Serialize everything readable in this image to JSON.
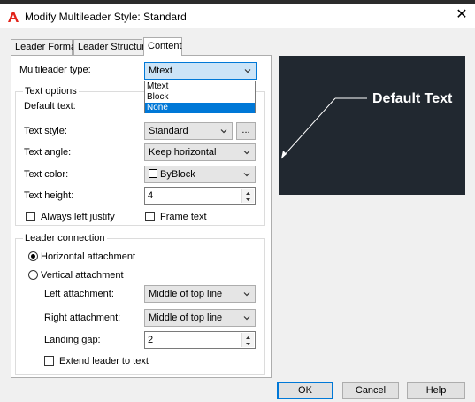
{
  "window": {
    "title": "Modify Multileader Style: Standard",
    "close_glyph": "✕",
    "app_icon": "autocad-a-icon",
    "accent_color": "#0078d7"
  },
  "tabs": [
    {
      "label": "Leader Format",
      "active": false
    },
    {
      "label": "Leader Structure",
      "active": false
    },
    {
      "label": "Content",
      "active": true
    }
  ],
  "content": {
    "multileader_type": {
      "label": "Multileader type:",
      "value": "Mtext",
      "expanded": true,
      "options": [
        "Mtext",
        "Block",
        "None"
      ],
      "highlighted_option": "None"
    },
    "text_options": {
      "title": "Text options",
      "default_text_label": "Default text:",
      "text_style": {
        "label": "Text style:",
        "value": "Standard",
        "browse_label": "..."
      },
      "text_angle": {
        "label": "Text angle:",
        "value": "Keep horizontal"
      },
      "text_color": {
        "label": "Text color:",
        "value": "ByBlock",
        "swatch_color": "#ffffff"
      },
      "text_height": {
        "label": "Text height:",
        "value": "4"
      },
      "always_left_justify": {
        "label": "Always left justify",
        "checked": false
      },
      "frame_text": {
        "label": "Frame text",
        "checked": false
      }
    },
    "leader_connection": {
      "title": "Leader connection",
      "horizontal": {
        "label": "Horizontal attachment",
        "selected": true
      },
      "vertical": {
        "label": "Vertical attachment",
        "selected": false
      },
      "left_attachment": {
        "label": "Left attachment:",
        "value": "Middle of top line"
      },
      "right_attachment": {
        "label": "Right attachment:",
        "value": "Middle of top line"
      },
      "landing_gap": {
        "label": "Landing gap:",
        "value": "2"
      },
      "extend_leader": {
        "label": "Extend leader to text",
        "checked": false
      }
    }
  },
  "preview": {
    "text": "Default Text",
    "background_color": "#212830",
    "line_color": "#ffffff"
  },
  "buttons": {
    "ok": "OK",
    "cancel": "Cancel",
    "help": "Help"
  }
}
